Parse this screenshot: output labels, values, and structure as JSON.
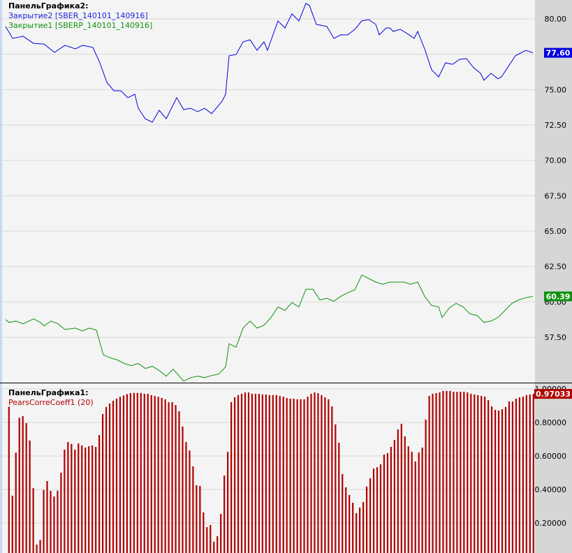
{
  "top_panel": {
    "title": "ПанельГрафика2:",
    "legend": [
      {
        "label": "Закрытие2 [SBER_140101_140916]",
        "color": "#0000e0"
      },
      {
        "label": "Закрытие1 [SBERP_140101_140916]",
        "color": "#109010"
      }
    ],
    "last_values": [
      {
        "text": "77.60",
        "value": 77.6,
        "color": "#0000e0"
      },
      {
        "text": "60.39",
        "value": 60.39,
        "color": "#109010"
      }
    ]
  },
  "bottom_panel": {
    "title": "ПанельГрафика1:",
    "legend": [
      {
        "label": "PearsCorreCoeff1 (20)",
        "color": "#b00000"
      }
    ],
    "last_value": {
      "text": "0.97033",
      "value": 0.97033,
      "color": "#b00000"
    }
  },
  "chart_data": [
    {
      "type": "line",
      "title": "ПанельГрафика2:",
      "ylim": [
        53.5,
        81.3
      ],
      "xlim": [
        0,
        151
      ],
      "y_ticks": [
        "80.00",
        "77.50",
        "75.00",
        "72.50",
        "70.00",
        "67.50",
        "65.00",
        "62.50",
        "60.00",
        "57.50"
      ],
      "y_tick_values": [
        80,
        77.5,
        75,
        72.5,
        70,
        67.5,
        65,
        62.5,
        60,
        57.5
      ],
      "grid": true,
      "series": [
        {
          "name": "Закрытие2 [SBER_140101_140916]",
          "x": [
            0,
            2,
            5,
            8,
            11,
            14,
            17,
            20,
            22,
            25,
            27,
            29,
            31,
            33,
            35,
            37,
            38,
            40,
            42,
            44,
            46,
            49,
            51,
            53,
            55,
            57,
            59,
            62,
            63,
            64,
            66,
            68,
            70,
            72,
            74,
            75,
            78,
            80,
            82,
            84,
            86,
            87,
            89,
            92,
            94,
            96,
            98,
            100,
            102,
            104,
            106,
            107,
            109,
            110,
            111,
            113,
            115,
            117,
            118,
            120,
            122,
            124,
            126,
            128,
            130,
            132,
            134,
            136,
            137,
            139,
            141,
            142,
            144,
            146,
            149,
            151
          ],
          "values": [
            79.46,
            78.62,
            78.77,
            78.27,
            78.22,
            77.63,
            78.13,
            77.88,
            78.13,
            77.98,
            76.89,
            75.51,
            74.92,
            74.92,
            74.43,
            74.67,
            73.68,
            72.94,
            72.7,
            73.54,
            72.94,
            74.43,
            73.59,
            73.68,
            73.44,
            73.68,
            73.3,
            74.18,
            74.67,
            77.39,
            77.48,
            78.37,
            78.52,
            77.78,
            78.37,
            77.78,
            79.85,
            79.36,
            80.35,
            79.85,
            81.09,
            80.94,
            79.61,
            79.46,
            78.62,
            78.87,
            78.87,
            79.26,
            79.85,
            79.95,
            79.61,
            78.87,
            79.36,
            79.36,
            79.11,
            79.26,
            78.96,
            78.62,
            79.11,
            77.88,
            76.4,
            75.9,
            76.89,
            76.79,
            77.14,
            77.19,
            76.55,
            76.15,
            75.66,
            76.15,
            75.76,
            75.9,
            76.65,
            77.39,
            77.78,
            77.6
          ]
        },
        {
          "name": "Закрытие1 [SBERP_140101_140916]",
          "x": [
            0,
            1,
            3,
            5,
            8,
            10,
            11,
            13,
            15,
            17,
            20,
            22,
            24,
            26,
            28,
            30,
            32,
            34,
            36,
            38,
            40,
            42,
            44,
            46,
            48,
            51,
            53,
            55,
            57,
            59,
            61,
            63,
            64,
            66,
            68,
            70,
            72,
            74,
            76,
            78,
            80,
            82,
            84,
            86,
            88,
            90,
            92,
            94,
            96,
            98,
            100,
            102,
            104,
            106,
            108,
            110,
            112,
            114,
            116,
            118,
            120,
            122,
            124,
            125,
            127,
            129,
            131,
            133,
            135,
            137,
            139,
            141,
            143,
            145,
            147,
            149,
            151
          ],
          "values": [
            58.75,
            58.55,
            58.65,
            58.45,
            58.8,
            58.55,
            58.3,
            58.65,
            58.45,
            58.05,
            58.15,
            57.95,
            58.15,
            58.0,
            56.25,
            56.05,
            55.9,
            55.65,
            55.5,
            55.65,
            55.3,
            55.45,
            55.15,
            54.75,
            55.25,
            54.4,
            54.65,
            54.75,
            54.65,
            54.8,
            54.9,
            55.4,
            57.05,
            56.8,
            58.15,
            58.65,
            58.15,
            58.35,
            58.9,
            59.65,
            59.4,
            59.95,
            59.65,
            60.9,
            60.9,
            60.15,
            60.25,
            60.05,
            60.4,
            60.65,
            60.85,
            61.9,
            61.65,
            61.4,
            61.25,
            61.4,
            61.4,
            61.4,
            61.25,
            61.4,
            60.4,
            59.75,
            59.65,
            58.9,
            59.55,
            59.9,
            59.65,
            59.15,
            59.05,
            58.55,
            58.65,
            58.9,
            59.4,
            59.9,
            60.15,
            60.3,
            60.39
          ]
        }
      ]
    },
    {
      "type": "bar",
      "title": "ПанельГрафика1:",
      "ylim": [
        0,
        1.0
      ],
      "y_ticks": [
        "1.00000",
        "0.80000",
        "0.60000",
        "0.40000",
        "0.20000"
      ],
      "y_tick_values": [
        1.0,
        0.8,
        0.6,
        0.4,
        0.2
      ],
      "grid": true,
      "series": [
        {
          "name": "PearsCorreCoeff1 (20)",
          "values": [
            0.894,
            0.363,
            0.62,
            0.828,
            0.838,
            0.796,
            0.692,
            0.408,
            0.071,
            0.099,
            0.397,
            0.45,
            0.392,
            0.358,
            0.392,
            0.5,
            0.638,
            0.683,
            0.672,
            0.638,
            0.675,
            0.663,
            0.65,
            0.658,
            0.663,
            0.654,
            0.725,
            0.85,
            0.892,
            0.913,
            0.929,
            0.942,
            0.953,
            0.961,
            0.969,
            0.975,
            0.976,
            0.976,
            0.976,
            0.971,
            0.971,
            0.963,
            0.958,
            0.953,
            0.946,
            0.938,
            0.921,
            0.921,
            0.904,
            0.867,
            0.775,
            0.683,
            0.633,
            0.538,
            0.425,
            0.421,
            0.263,
            0.175,
            0.188,
            0.088,
            0.121,
            0.254,
            0.483,
            0.625,
            0.921,
            0.95,
            0.963,
            0.971,
            0.979,
            0.979,
            0.971,
            0.971,
            0.971,
            0.967,
            0.967,
            0.963,
            0.963,
            0.963,
            0.958,
            0.954,
            0.946,
            0.942,
            0.942,
            0.938,
            0.938,
            0.938,
            0.954,
            0.971,
            0.979,
            0.975,
            0.963,
            0.95,
            0.938,
            0.896,
            0.788,
            0.679,
            0.492,
            0.413,
            0.367,
            0.321,
            0.258,
            0.292,
            0.325,
            0.417,
            0.467,
            0.525,
            0.533,
            0.55,
            0.608,
            0.617,
            0.654,
            0.696,
            0.758,
            0.792,
            0.717,
            0.658,
            0.625,
            0.567,
            0.621,
            0.65,
            0.817,
            0.958,
            0.971,
            0.975,
            0.979,
            0.988,
            0.988,
            0.988,
            0.983,
            0.983,
            0.983,
            0.983,
            0.979,
            0.971,
            0.967,
            0.963,
            0.958,
            0.954,
            0.933,
            0.896,
            0.875,
            0.871,
            0.879,
            0.892,
            0.925,
            0.925,
            0.942,
            0.95,
            0.954,
            0.963,
            0.967,
            0.97033
          ]
        }
      ]
    }
  ]
}
